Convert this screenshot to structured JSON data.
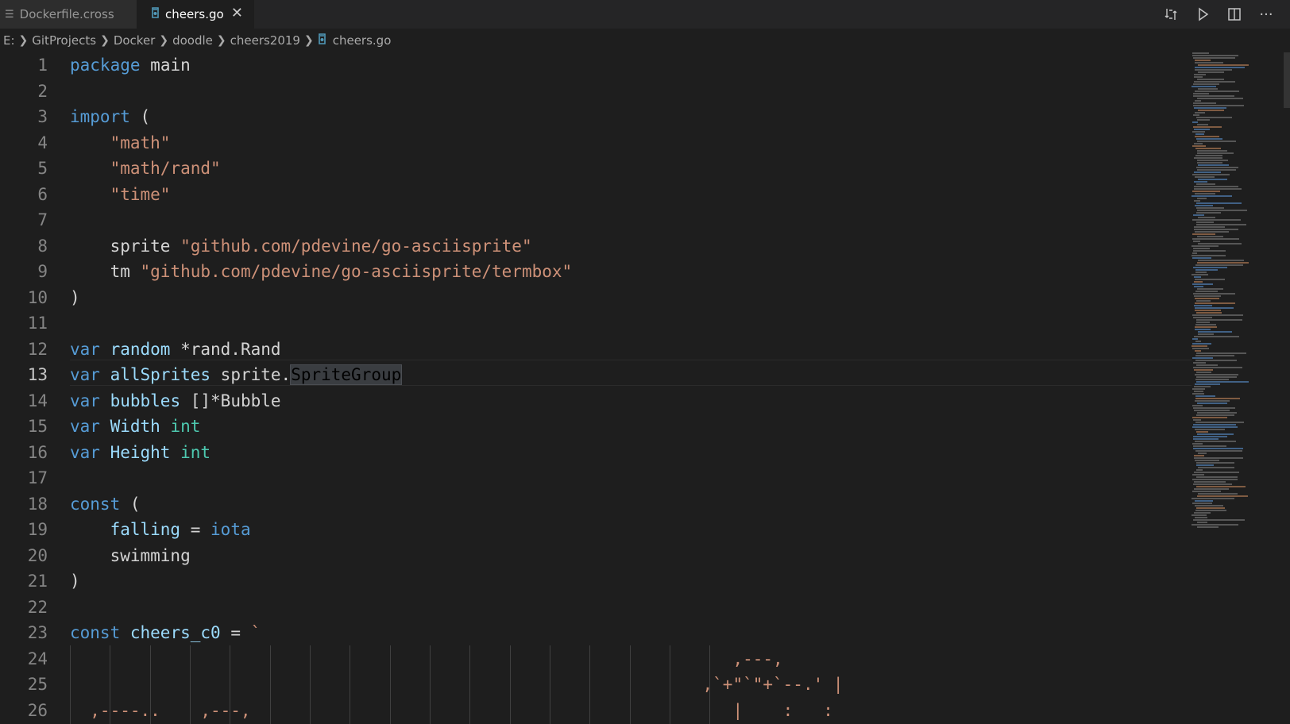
{
  "tabs": [
    {
      "label": "Dockerfile.cross",
      "icon": "lines-icon",
      "active": false
    },
    {
      "label": "cheers.go",
      "icon": "go-file-icon",
      "active": true
    }
  ],
  "tab_close_glyph": "✕",
  "actions": [
    {
      "name": "open-changes-icon"
    },
    {
      "name": "run-icon"
    },
    {
      "name": "split-editor-icon"
    },
    {
      "name": "more-actions-icon",
      "glyph": "···"
    }
  ],
  "breadcrumb": [
    "E:",
    "GitProjects",
    "Docker",
    "doodle",
    "cheers2019",
    "cheers.go"
  ],
  "editor": {
    "current_line": 13,
    "lines": [
      {
        "n": "1",
        "tokens": [
          [
            "k",
            "package"
          ],
          [
            "d",
            " "
          ],
          [
            "d",
            "main"
          ]
        ]
      },
      {
        "n": "2",
        "tokens": []
      },
      {
        "n": "3",
        "tokens": [
          [
            "k",
            "import"
          ],
          [
            "d",
            " ("
          ]
        ]
      },
      {
        "n": "4",
        "tokens": [
          [
            "d",
            "    "
          ],
          [
            "s",
            "\"math\""
          ]
        ]
      },
      {
        "n": "5",
        "tokens": [
          [
            "d",
            "    "
          ],
          [
            "s",
            "\"math/rand\""
          ]
        ]
      },
      {
        "n": "6",
        "tokens": [
          [
            "d",
            "    "
          ],
          [
            "s",
            "\"time\""
          ]
        ]
      },
      {
        "n": "7",
        "tokens": []
      },
      {
        "n": "8",
        "tokens": [
          [
            "d",
            "    sprite "
          ],
          [
            "s",
            "\"github.com/pdevine/go-asciisprite\""
          ]
        ]
      },
      {
        "n": "9",
        "tokens": [
          [
            "d",
            "    tm "
          ],
          [
            "s",
            "\"github.com/pdevine/go-asciisprite/termbox\""
          ]
        ]
      },
      {
        "n": "10",
        "tokens": [
          [
            "d",
            ")"
          ]
        ]
      },
      {
        "n": "11",
        "tokens": []
      },
      {
        "n": "12",
        "tokens": [
          [
            "k",
            "var"
          ],
          [
            "d",
            " "
          ],
          [
            "v",
            "random"
          ],
          [
            "d",
            " *rand.Rand"
          ]
        ]
      },
      {
        "n": "13",
        "tokens": [
          [
            "k",
            "var"
          ],
          [
            "d",
            " "
          ],
          [
            "v",
            "allSprites"
          ],
          [
            "d",
            " sprite."
          ],
          [
            "hl",
            "SpriteGroup"
          ]
        ]
      },
      {
        "n": "14",
        "tokens": [
          [
            "k",
            "var"
          ],
          [
            "d",
            " "
          ],
          [
            "v",
            "bubbles"
          ],
          [
            "d",
            " []*Bubble"
          ]
        ]
      },
      {
        "n": "15",
        "tokens": [
          [
            "k",
            "var"
          ],
          [
            "d",
            " "
          ],
          [
            "v",
            "Width"
          ],
          [
            "d",
            " "
          ],
          [
            "t",
            "int"
          ]
        ]
      },
      {
        "n": "16",
        "tokens": [
          [
            "k",
            "var"
          ],
          [
            "d",
            " "
          ],
          [
            "v",
            "Height"
          ],
          [
            "d",
            " "
          ],
          [
            "t",
            "int"
          ]
        ]
      },
      {
        "n": "17",
        "tokens": []
      },
      {
        "n": "18",
        "tokens": [
          [
            "k",
            "const"
          ],
          [
            "d",
            " ("
          ]
        ]
      },
      {
        "n": "19",
        "tokens": [
          [
            "d",
            "    "
          ],
          [
            "v",
            "falling"
          ],
          [
            "d",
            " = "
          ],
          [
            "k",
            "iota"
          ]
        ]
      },
      {
        "n": "20",
        "tokens": [
          [
            "d",
            "    swimming"
          ]
        ]
      },
      {
        "n": "21",
        "tokens": [
          [
            "d",
            ")"
          ]
        ]
      },
      {
        "n": "22",
        "tokens": []
      },
      {
        "n": "23",
        "tokens": [
          [
            "k",
            "const"
          ],
          [
            "d",
            " "
          ],
          [
            "v",
            "cheers_c0"
          ],
          [
            "d",
            " = "
          ],
          [
            "s",
            "`"
          ]
        ]
      },
      {
        "n": "24",
        "tokens": [
          [
            "s",
            "                                                                  ,---,"
          ]
        ]
      },
      {
        "n": "25",
        "tokens": [
          [
            "s",
            "                                                               ,`+\"`\"+`--.' |"
          ]
        ]
      },
      {
        "n": "26",
        "tokens": [
          [
            "s",
            "  ,----..    ,---,                                                |    :   :"
          ]
        ]
      }
    ]
  },
  "colors": {
    "keyword": "#569cd6",
    "string": "#ce9178",
    "variable": "#9cdcfe",
    "type": "#4ec9b0",
    "default": "#d4d4d4",
    "background": "#1e1e1e"
  }
}
